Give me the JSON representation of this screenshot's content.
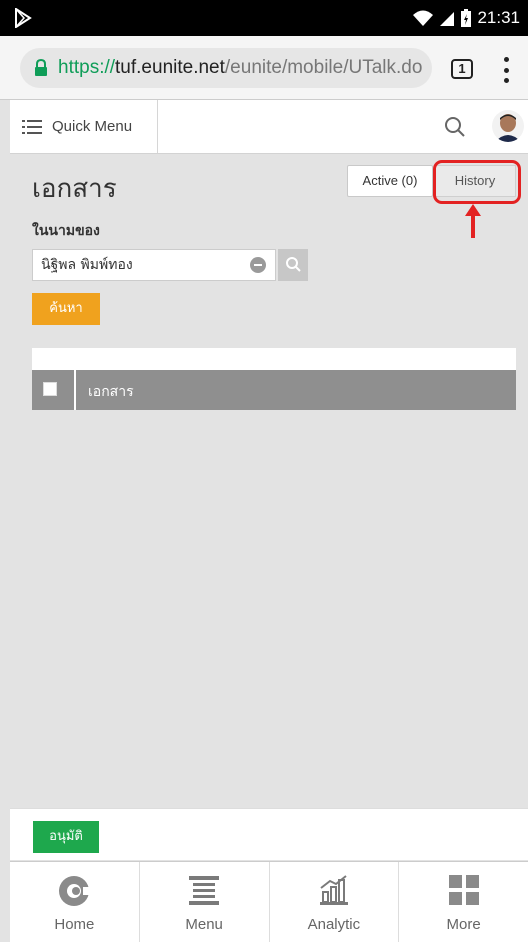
{
  "status_bar": {
    "time": "21:31"
  },
  "browser": {
    "url_scheme": "https://",
    "url_host": "tuf.eunite.net",
    "url_path": "/eunite/mobile/UTalk.do",
    "tab_count": "1"
  },
  "app_header": {
    "quick_menu_label": "Quick Menu"
  },
  "page": {
    "title": "เอกสาร",
    "active_tab_label": "Active (0)",
    "history_tab_label": "History",
    "owner_label": "ในนามของ",
    "owner_value": "นิฐิพล พิมพ์ทอง",
    "find_button": "ค้นหา",
    "grid_column": "เอกสาร"
  },
  "action_bar": {
    "approve_button": "อนุมัติ"
  },
  "bottom_nav": {
    "items": [
      {
        "label": "Home",
        "icon": "home-icon"
      },
      {
        "label": "Menu",
        "icon": "menu-icon"
      },
      {
        "label": "Analytic",
        "icon": "analytic-icon"
      },
      {
        "label": "More",
        "icon": "more-icon"
      }
    ]
  },
  "colors": {
    "highlight": "#e32222",
    "find_button": "#f0a21e",
    "approve_button": "#1ea84d",
    "secure_scheme": "#0f9d58"
  }
}
